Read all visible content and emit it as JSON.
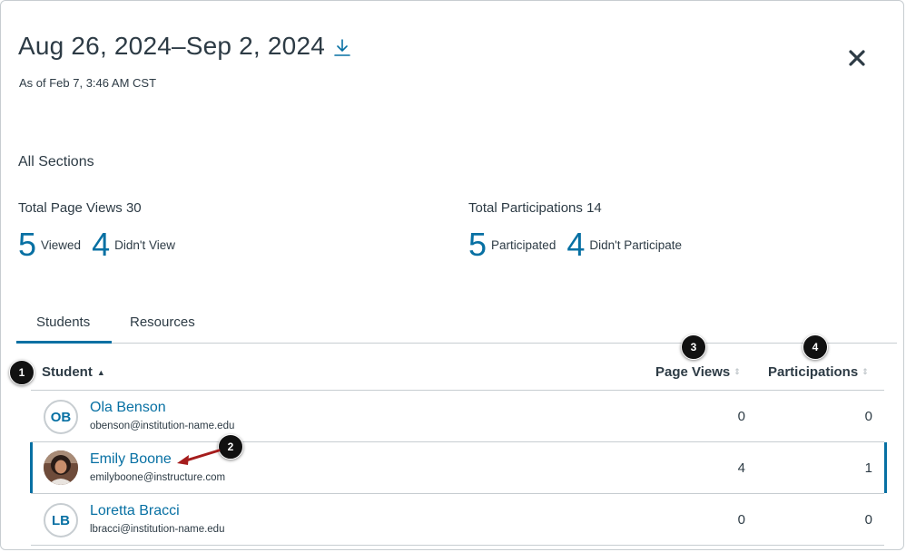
{
  "header": {
    "title": "Aug 26, 2024–Sep 2, 2024",
    "as_of": "As of Feb 7, 3:46 AM CST",
    "download_icon": "download-icon",
    "close_icon": "close-icon"
  },
  "filter": {
    "section": "All Sections"
  },
  "page_views": {
    "title": "Total Page Views 30",
    "viewed_count": "5",
    "viewed_label": "Viewed",
    "not_viewed_count": "4",
    "not_viewed_label": "Didn't View"
  },
  "participations": {
    "title": "Total Participations 14",
    "participated_count": "5",
    "participated_label": "Participated",
    "not_participated_count": "4",
    "not_participated_label": "Didn't Participate"
  },
  "tabs": [
    {
      "label": "Students",
      "active": true
    },
    {
      "label": "Resources",
      "active": false
    }
  ],
  "table": {
    "headers": {
      "student": "Student",
      "page_views": "Page Views",
      "participations": "Participations"
    },
    "sort_asc_glyph": "▲",
    "sort_glyph": "⇕",
    "rows": [
      {
        "initials": "OB",
        "name": "Ola Benson",
        "email": "obenson@institution-name.edu",
        "page_views": "0",
        "participations": "0"
      },
      {
        "initials": "",
        "name": "Emily Boone",
        "email": "emilyboone@instructure.com",
        "page_views": "4",
        "participations": "1"
      },
      {
        "initials": "LB",
        "name": "Loretta Bracci",
        "email": "lbracci@institution-name.edu",
        "page_views": "0",
        "participations": "0"
      }
    ]
  },
  "callouts": [
    "1",
    "2",
    "3",
    "4"
  ],
  "colors": {
    "accent": "#0770a3",
    "text": "#2d3b45",
    "border": "#c7cdd1",
    "arrow": "#a51c1c"
  }
}
